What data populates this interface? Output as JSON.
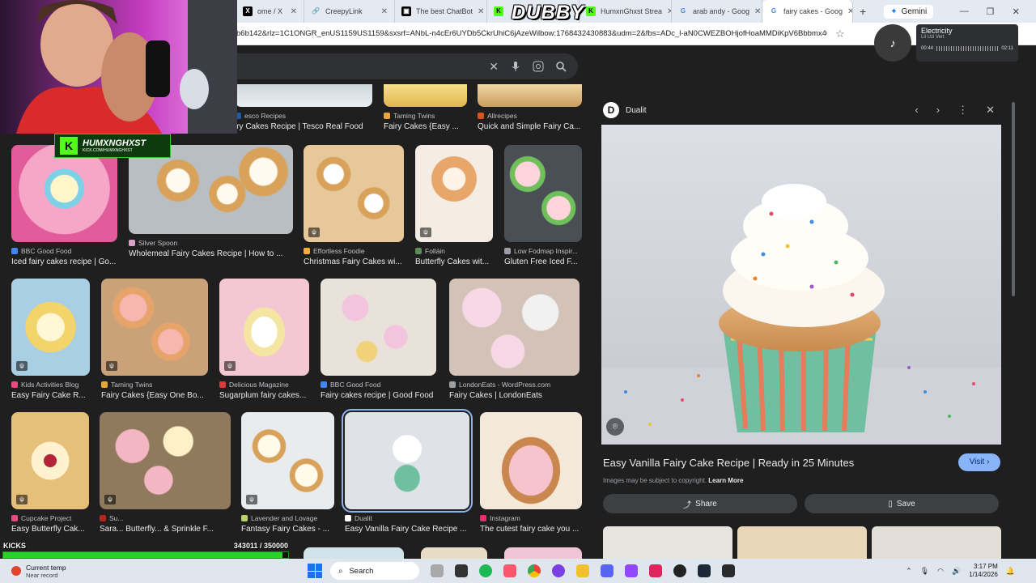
{
  "browser": {
    "tabs": [
      {
        "label": "ome / X",
        "icon": "x-logo-icon",
        "fav_color": "#000000",
        "glyph": "X"
      },
      {
        "label": "CreepyLink",
        "icon": "link-icon",
        "fav_color": "#ffffff",
        "glyph": "🔗"
      },
      {
        "label": "The best ChatBot",
        "icon": "chatbot-icon",
        "fav_color": "#000000",
        "glyph": "▣"
      },
      {
        "label": "",
        "icon": "kick-icon",
        "fav_color": "#53fc18",
        "glyph": "K"
      },
      {
        "label": "HumxnGhxst Strea",
        "icon": "kick-icon",
        "fav_color": "#53fc18",
        "glyph": "K"
      },
      {
        "label": "arab andy - Goog",
        "icon": "google-icon",
        "fav_color": "#ffffff",
        "glyph": "G"
      },
      {
        "label": "fairy cakes - Goog",
        "icon": "google-icon",
        "fav_color": "#ffffff",
        "glyph": "G"
      }
    ],
    "gemini_label": "Gemini",
    "url": "b6b142&rlz=1C1ONGR_enUS1159US1159&sxsrf=ANbL-n4cEr6UYDb5CkrUhiC6jAzeWilbow:1768432430883&udm=2&fbs=ADc_l-aN0CWEZBOHjofHoaMMDiKpV6Bbbmx4QVa..."
  },
  "overlay": {
    "dubby": "DUBBY",
    "streamer_name": "HUMXNGHXST",
    "streamer_url": "KICK.COM/HUMXNGHXST",
    "music_title": "Electricity",
    "music_artist": "Lil Uzi Vert",
    "music_elapsed": "00:44",
    "music_total": "02:11",
    "kicks_label": "KICKS",
    "kicks_count": "343011 / 350000",
    "kicks_progress": 0.98
  },
  "results": {
    "row0": [
      {
        "source": "esco Recipes",
        "title": "iry Cakes Recipe | Tesco Real Food",
        "fav": "#1f5aa6"
      },
      {
        "source": "Taming Twins",
        "title": "Fairy Cakes {Easy ...",
        "fav": "#e8a53a"
      },
      {
        "source": "Allrecipes",
        "title": "Quick and Simple Fairy Ca...",
        "fav": "#d9531e"
      }
    ],
    "row1": [
      {
        "source": "BBC Good Food",
        "title": "Iced fairy cakes recipe | Go...",
        "fav": "#4285f4"
      },
      {
        "source": "Silver Spoon",
        "title": "Wholemeal Fairy Cakes Recipe | How to ...",
        "fav": "#d6a2c9"
      },
      {
        "source": "Effortless Foodie",
        "title": "Christmas Fairy Cakes wi...",
        "fav": "#f2b134"
      },
      {
        "source": "Folláin",
        "title": "Butterfly Cakes wit...",
        "fav": "#5b8c5a"
      },
      {
        "source": "Low Fodmap Inspir...",
        "title": "Gluten Free Iced F...",
        "fav": "#9aa0a6"
      }
    ],
    "row2": [
      {
        "source": "Kids Activities Blog",
        "title": "Easy Fairy Cake R...",
        "fav": "#e94b7e"
      },
      {
        "source": "Taming Twins",
        "title": "Fairy Cakes {Easy One Bo...",
        "fav": "#e8a53a"
      },
      {
        "source": "Delicious Magazine",
        "title": "Sugarplum fairy cakes...",
        "fav": "#d93a3a"
      },
      {
        "source": "BBC Good Food",
        "title": "Fairy cakes recipe | Good Food",
        "fav": "#4285f4"
      },
      {
        "source": "LondonEats - WordPress.com",
        "title": "Fairy Cakes | LondonEats",
        "fav": "#9aa0a6"
      }
    ],
    "row3": [
      {
        "source": "Cupcake Project",
        "title": "Easy Butterfly Cak...",
        "fav": "#e94b7e"
      },
      {
        "source": "Su...",
        "title": "Sara... Butterfly... & Sprinkle F...",
        "fav": "#b3261e"
      },
      {
        "source": "Lavender and Lovage",
        "title": "Fantasy Fairy Cakes - ...",
        "fav": "#b8d36b"
      },
      {
        "source": "Dualit",
        "title": "Easy Vanilla Fairy Cake Recipe ...",
        "fav": "#ffffff"
      },
      {
        "source": "Instagram",
        "title": "The cutest fairy cake you ...",
        "fav": "#e1306c"
      }
    ]
  },
  "panel": {
    "source": "Dualit",
    "source_initial": "D",
    "title": "Easy Vanilla Fairy Cake Recipe | Ready in 25 Minutes",
    "visit_label": "Visit",
    "copyright": "Images may be subject to copyright.",
    "learn_more": "Learn More",
    "share_label": "Share",
    "save_label": "Save"
  },
  "taskbar": {
    "weather_title": "Current temp",
    "weather_sub": "Near record",
    "search_label": "Search",
    "time": "3:17 PM",
    "date": "1/14/2026"
  }
}
